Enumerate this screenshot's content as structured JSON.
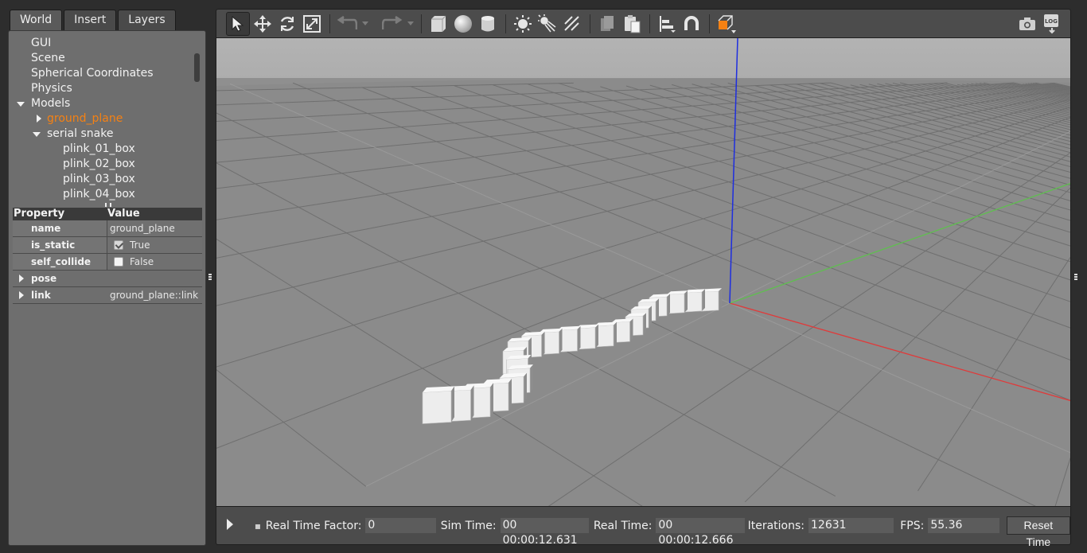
{
  "left_tabs": [
    {
      "label": "World",
      "active": true
    },
    {
      "label": "Insert",
      "active": false
    },
    {
      "label": "Layers",
      "active": false
    }
  ],
  "tree": {
    "gui": "GUI",
    "scene": "Scene",
    "spherical": "Spherical Coordinates",
    "physics": "Physics",
    "models": "Models",
    "ground_plane": "ground_plane",
    "serial_snake": "serial snake",
    "plinks": [
      "plink_01_box",
      "plink_02_box",
      "plink_03_box",
      "plink_04_box"
    ]
  },
  "properties": {
    "header_property": "Property",
    "header_value": "Value",
    "rows": [
      {
        "name": "name",
        "value": "ground_plane"
      },
      {
        "name": "is_static",
        "value": "True",
        "checked": true
      },
      {
        "name": "self_collide",
        "value": "False",
        "checked": false
      }
    ],
    "groups": [
      {
        "name": "pose",
        "value": ""
      },
      {
        "name": "link",
        "value": "ground_plane::link"
      }
    ]
  },
  "toolbar": {
    "icons": [
      "select-arrow-icon",
      "translate-icon",
      "rotate-icon",
      "scale-icon",
      "undo-icon",
      "redo-icon",
      "box-shape-icon",
      "sphere-shape-icon",
      "cylinder-shape-icon",
      "point-light-icon",
      "spot-light-icon",
      "directional-light-icon",
      "copy-icon",
      "paste-icon",
      "align-icon",
      "snap-magnet-icon",
      "view-angle-icon",
      "screenshot-camera-icon",
      "log-record-icon"
    ],
    "log_text": "LOG"
  },
  "status": {
    "rtf_label": "Real Time Factor:",
    "rtf_value": "0",
    "sim_time_label": "Sim Time:",
    "sim_time_value": "00 00:00:12.631",
    "real_time_label": "Real Time:",
    "real_time_value": "00 00:00:12.666",
    "iterations_label": "Iterations:",
    "iterations_value": "12631",
    "fps_label": "FPS:",
    "fps_value": "55.36",
    "reset_label": "Reset Time"
  },
  "colors": {
    "selected_text": "#f58113",
    "axis_x": "#e03a3a",
    "axis_y": "#5fbf4f",
    "axis_z": "#1e2ee0"
  }
}
